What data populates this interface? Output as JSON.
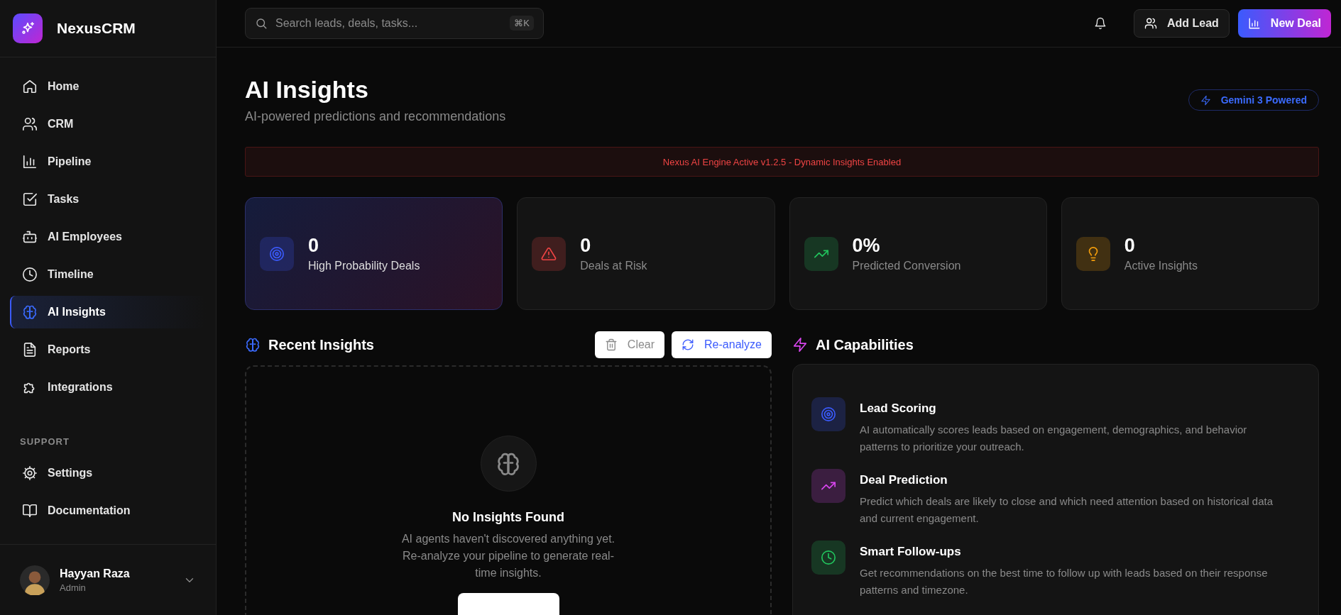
{
  "sidebar": {
    "brand": "NexusCRM",
    "items": [
      {
        "label": "Home",
        "selected": false
      },
      {
        "label": "CRM",
        "selected": false
      },
      {
        "label": "Pipeline",
        "selected": false
      },
      {
        "label": "Tasks",
        "selected": false
      },
      {
        "label": "AI Employees",
        "selected": false
      },
      {
        "label": "Timeline",
        "selected": false
      },
      {
        "label": "AI Insights",
        "selected": true
      },
      {
        "label": "Reports",
        "selected": false
      },
      {
        "label": "Integrations",
        "selected": false
      }
    ],
    "section_label": "SUPPORT",
    "support_items": [
      {
        "label": "Settings",
        "selected": false
      },
      {
        "label": "Documentation",
        "selected": false
      }
    ],
    "user": {
      "name": "Hayyan Raza",
      "role": "Admin"
    }
  },
  "topbar": {
    "search": {
      "placeholder": "Search leads, deals, tasks...",
      "shortcut": "⌘K"
    },
    "buttons": [
      {
        "label": "Add Lead",
        "kind": "secondary"
      },
      {
        "label": "New Deal",
        "kind": "primary"
      }
    ]
  },
  "header": {
    "title": "AI Insights",
    "subtitle": "AI-powered predictions and recommendations",
    "badge": "Gemini 3 Powered"
  },
  "banner": "Nexus AI Engine Active v1.2.5 - Dynamic Insights Enabled",
  "stats": [
    {
      "value": "0",
      "label": "High Probability Deals",
      "color": "#3b5bfd",
      "highlighted": true
    },
    {
      "value": "0",
      "label": "Deals at Risk",
      "color": "#ef4444",
      "highlighted": false
    },
    {
      "value": "0%",
      "label": "Predicted Conversion",
      "color": "#22c55e",
      "highlighted": false
    },
    {
      "value": "0",
      "label": "Active Insights",
      "color": "#f59e0b",
      "highlighted": false
    }
  ],
  "recent": {
    "title": "Recent Insights",
    "actions": [
      {
        "label": "Clear",
        "disabled": true
      },
      {
        "label": "Re-analyze",
        "disabled": false
      }
    ],
    "empty": {
      "title": "No Insights Found",
      "message": "AI agents haven't discovered anything yet. Re-analyze your pipeline to generate real-time insights."
    }
  },
  "capabilities": {
    "title": "AI Capabilities",
    "items": [
      {
        "title": "Lead Scoring",
        "description": "AI automatically scores leads based on engagement, demographics, and behavior patterns to prioritize your outreach.",
        "color": "#3b5bfd"
      },
      {
        "title": "Deal Prediction",
        "description": "Predict which deals are likely to close and which need attention based on historical data and current engagement.",
        "color": "#d946ef"
      },
      {
        "title": "Smart Follow-ups",
        "description": "Get recommendations on the best time to follow up with leads based on their response patterns and timezone.",
        "color": "#22c55e"
      }
    ]
  }
}
